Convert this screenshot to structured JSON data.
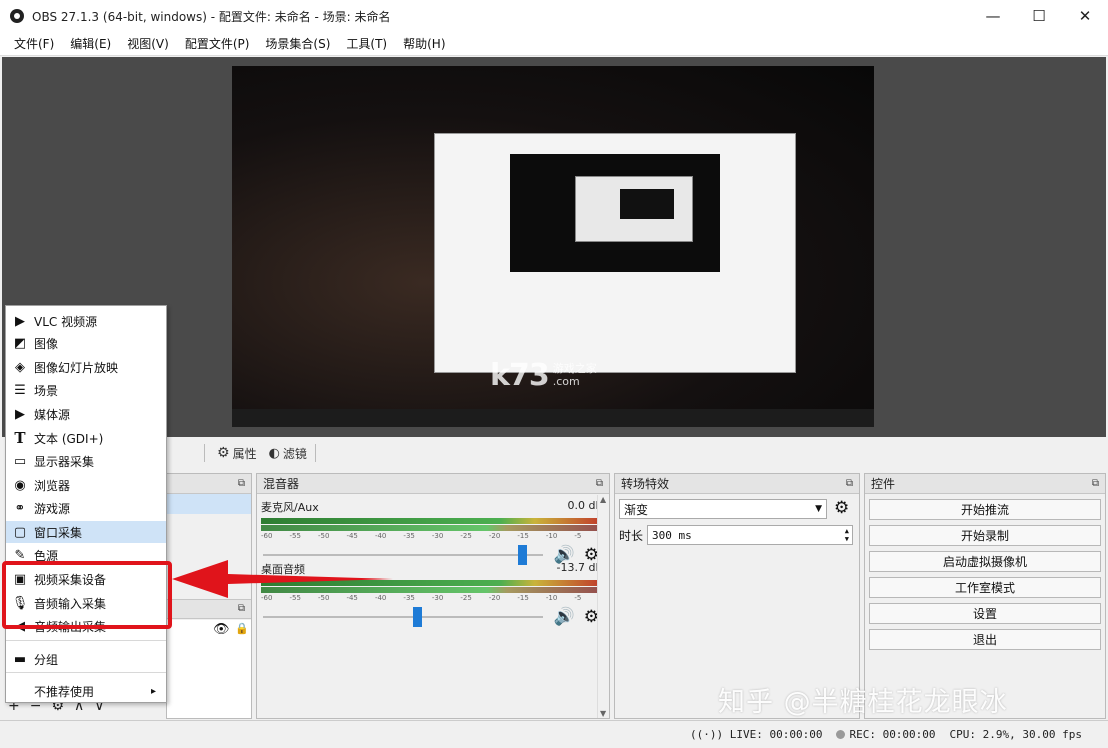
{
  "window": {
    "title": "OBS 27.1.3 (64-bit, windows) - 配置文件: 未命名 - 场景: 未命名",
    "minimize": "—",
    "maximize": "☐",
    "close": "✕"
  },
  "menu": [
    "文件(F)",
    "编辑(E)",
    "视图(V)",
    "配置文件(P)",
    "场景集合(S)",
    "工具(T)",
    "帮助(H)"
  ],
  "source_toolbar": {
    "properties_label": "属性",
    "filters_label": "滤镜"
  },
  "context_menu": {
    "items": [
      {
        "label": "VLC 视频源",
        "icon": "play-icon"
      },
      {
        "label": "图像",
        "icon": "image-icon"
      },
      {
        "label": "图像幻灯片放映",
        "icon": "slideshow-icon"
      },
      {
        "label": "场景",
        "icon": "scene-icon"
      },
      {
        "label": "媒体源",
        "icon": "play-icon"
      },
      {
        "label": "文本 (GDI+)",
        "icon": "text-icon"
      },
      {
        "label": "显示器采集",
        "icon": "monitor-icon"
      },
      {
        "label": "浏览器",
        "icon": "globe-icon"
      },
      {
        "label": "游戏源",
        "icon": "gamepad-icon"
      },
      {
        "label": "窗口采集",
        "icon": "window-icon"
      },
      {
        "label": "色源",
        "icon": "brush-icon"
      },
      {
        "label": "视频采集设备",
        "icon": "camera-icon"
      },
      {
        "label": "音频输入采集",
        "icon": "microphone-icon"
      },
      {
        "label": "音频输出采集",
        "icon": "speaker-icon"
      },
      {
        "label": "分组",
        "icon": "folder-icon"
      },
      {
        "label": "不推荐使用",
        "icon": "chevron-right-icon"
      }
    ],
    "selected_index": 9
  },
  "mixer": {
    "title": "混音器",
    "tracks": [
      {
        "name": "麦克风/Aux",
        "db": "0.0 dB",
        "level": 0.86
      },
      {
        "name": "桌面音频",
        "db": "-13.7 dB",
        "level": 0.62
      }
    ],
    "tick_labels": [
      "-60",
      "-55",
      "-50",
      "-45",
      "-40",
      "-35",
      "-30",
      "-25",
      "-20",
      "-15",
      "-10",
      "-5",
      "0"
    ]
  },
  "transitions": {
    "title": "转场特效",
    "selected": "渐变",
    "duration_label": "时长",
    "duration_value": "300 ms"
  },
  "controls": {
    "title": "控件",
    "buttons": [
      "开始推流",
      "开始录制",
      "启动虚拟摄像机",
      "工作室模式",
      "设置",
      "退出"
    ]
  },
  "status": {
    "live": "LIVE: 00:00:00",
    "rec": "REC: 00:00:00",
    "cpu": "CPU: 2.9%, 30.00 fps"
  },
  "watermarks": {
    "preview": "k73",
    "preview_sub1": "游戏之家",
    "preview_sub2": ".com",
    "zhihu": "知乎 @半糖桂花龙眼冰"
  },
  "colors": {
    "highlight_red": "#e0141b",
    "selection_blue": "#cfe3f7",
    "slider_blue": "#1e7bd6"
  }
}
